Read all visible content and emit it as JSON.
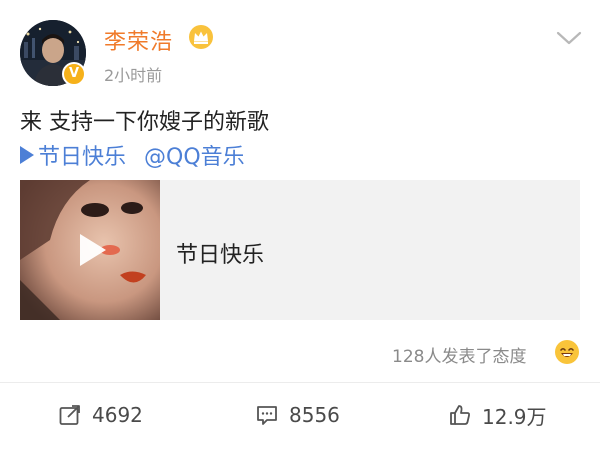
{
  "user": {
    "name": "李荣浩",
    "timestamp": "2小时前",
    "verified_badge": "V",
    "avatar_icon": "avatar-photo",
    "crown_icon": "crown-icon"
  },
  "post": {
    "text": "来 支持一下你嫂子的新歌",
    "topic_link": "节日快乐",
    "mention_link": "@QQ音乐"
  },
  "music_card": {
    "song_title": "节日快乐",
    "cover_icon": "album-cover",
    "play_icon": "play-icon"
  },
  "reactions": {
    "text": "128人发表了态度",
    "emoji_icon": "smiley-icon"
  },
  "actions": {
    "repost_count": "4692",
    "comment_count": "8556",
    "like_count": "12.9万"
  },
  "colors": {
    "username": "#f07a2a",
    "link": "#4c7fd6",
    "card_bg": "#f2f2f2",
    "badge": "#f6b11a",
    "muted_text": "#9a9a9a"
  }
}
